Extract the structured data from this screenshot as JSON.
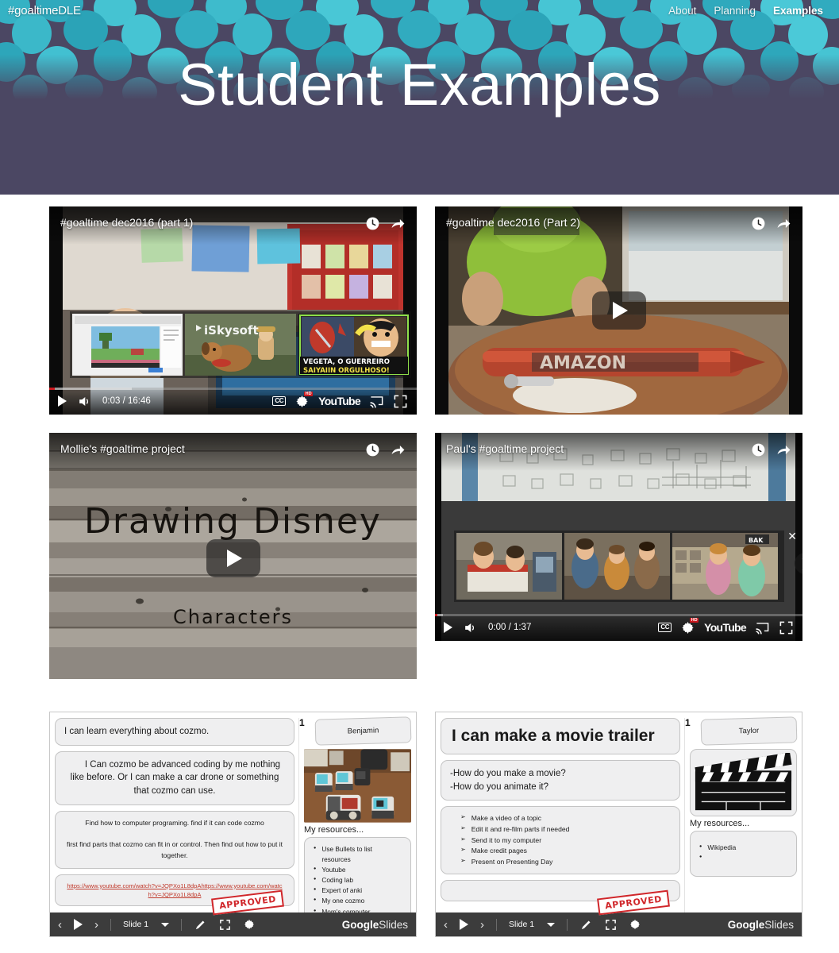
{
  "site": {
    "logo": "#goaltimeDLE",
    "nav": [
      {
        "label": "About",
        "active": false
      },
      {
        "label": "Planning",
        "active": false
      },
      {
        "label": "Examples",
        "active": true
      }
    ],
    "page_title": "Student Examples",
    "colors": {
      "hero_bg": "#4b4763",
      "accent_teal": "#31b6c8",
      "youtube_red": "#cc181e",
      "stamp_red": "#d0262a"
    }
  },
  "videos": [
    {
      "title": "#goaltime dec2016 (part 1)",
      "state": "playing-with-endscreen",
      "current_time": "0:03",
      "duration": "16:46",
      "time_display": "0:03 / 16:46",
      "controls": {
        "play": "play-icon",
        "volume": "volume-icon",
        "cc": "CC",
        "hd": "HD",
        "brand": "YouTube",
        "cast": "cast-icon",
        "fullscreen": "fullscreen-icon"
      },
      "related": [
        {
          "caption": ""
        },
        {
          "caption": "iSkysoft"
        },
        {
          "caption": "VEGETA, O GUERREIRO SAIYAIIN ORGULHOSO!"
        }
      ],
      "close_label": "✕"
    },
    {
      "title": "#goaltime dec2016 (Part 2)",
      "state": "paused",
      "time_display": "",
      "play_label": "play-button"
    },
    {
      "title": "Mollie's #goaltime project",
      "state": "paused",
      "overlay_line1": "Drawing Disney",
      "overlay_line2": "Characters"
    },
    {
      "title": "Paul's #goaltime project",
      "state": "endscreen",
      "current_time": "0:00",
      "duration": "1:37",
      "time_display": "0:00 / 1:37",
      "controls": {
        "play": "play-icon",
        "volume": "volume-icon",
        "cc": "CC",
        "hd": "HD",
        "brand": "YouTube",
        "cast": "cast-icon",
        "fullscreen": "fullscreen-icon"
      },
      "close_label": "✕",
      "next_label": "❯"
    }
  ],
  "slides": [
    {
      "number": "1",
      "student": "Benjamin",
      "goal": "I can learn everything about cozmo.",
      "questions": "I Can cozmo be advanced coding by me nothing like before. Or I can make a car drone or something that cozmo can use.",
      "steps": "Find how to computer programing.          find if it can code cozmo\n\nfirst find parts that cozmo can fit in or control. Then find out how to put it together.",
      "link": "https://www.youtube.com/watch?v=JQPXo1L8dpAhttps://www.youtube.com/watch?v=JQPXo1L8dpA",
      "resources_label": "My resources...",
      "resources": [
        "Use Bullets to list resources",
        "Youtube",
        "Coding lab",
        "Expert of anki",
        "My one cozmo",
        "Mom's computer"
      ],
      "stamp": "APPROVED",
      "toolbar": {
        "prev": "‹",
        "play": "play-icon",
        "next": "›",
        "slide_label": "Slide 1",
        "pen": "pen-icon",
        "fullscreen": "fullscreen-icon",
        "settings": "gear-icon",
        "brand_bold": "Google",
        "brand_light": "Slides"
      }
    },
    {
      "number": "1",
      "student": "Taylor",
      "goal": "I can make a movie trailer",
      "questions": "-How do you make a movie?\n-How do you animate it?",
      "steps_list": [
        "Make a  video of a topic",
        "Edit it and re-film parts if needed",
        "Send it to my computer",
        "Make credit pages",
        "Present on Presenting Day"
      ],
      "empty_box": "",
      "resources_label": "My resources...",
      "resources": [
        "Wikipedia",
        ""
      ],
      "stamp": "APPROVED",
      "toolbar": {
        "prev": "‹",
        "play": "play-icon",
        "next": "›",
        "slide_label": "Slide 1",
        "pen": "pen-icon",
        "fullscreen": "fullscreen-icon",
        "settings": "gear-icon",
        "brand_bold": "Google",
        "brand_light": "Slides"
      }
    }
  ]
}
